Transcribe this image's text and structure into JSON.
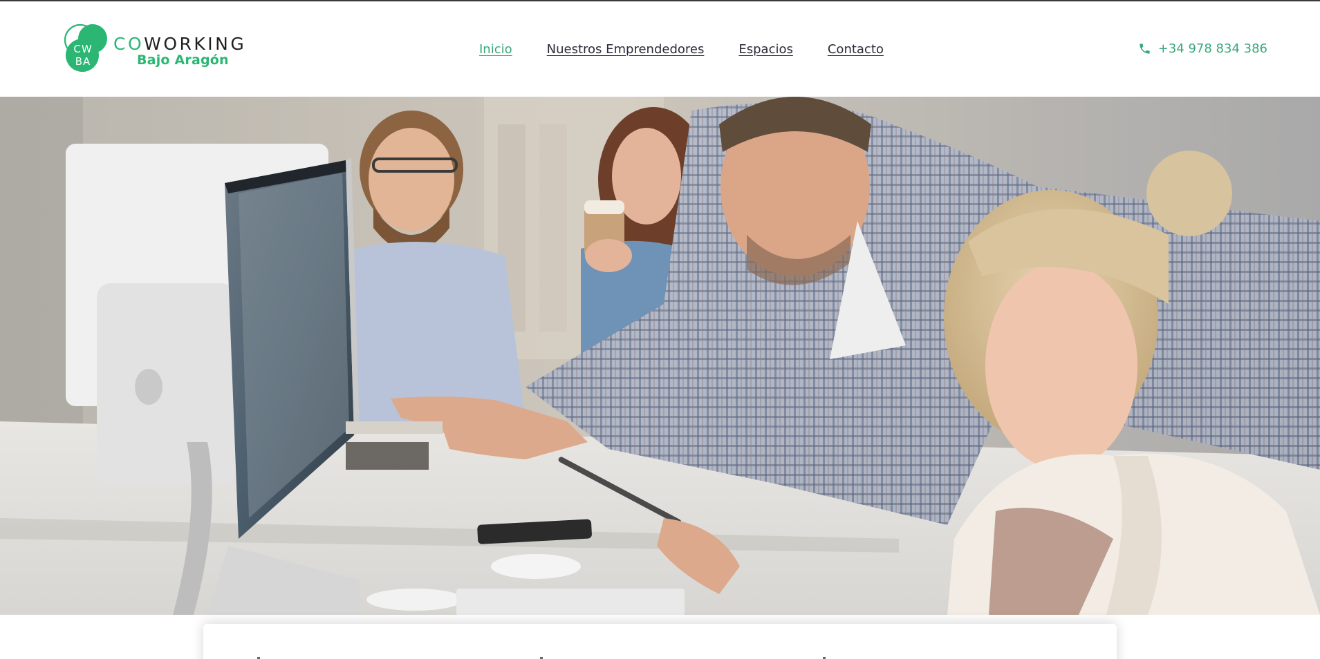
{
  "header": {
    "logo": {
      "monogram_top": "CW",
      "monogram_bottom": "BA",
      "wordmark_accent": "CO",
      "wordmark_rest": "WORKING",
      "subtitle": "Bajo Aragón",
      "brand_color": "#2bb673"
    },
    "nav": {
      "items": [
        {
          "label": "Inicio",
          "active": true
        },
        {
          "label": "Nuestros Emprendedores",
          "active": false
        },
        {
          "label": "Espacios",
          "active": false
        },
        {
          "label": "Contacto",
          "active": false
        }
      ],
      "active_color": "#38a87a",
      "text_color": "#2a2a3a"
    },
    "phone": {
      "icon": "phone-icon",
      "number": "+34 978 834 386",
      "color": "#38a87a"
    }
  },
  "hero": {
    "image_alt": "photo-of-coworkers-at-computer"
  }
}
